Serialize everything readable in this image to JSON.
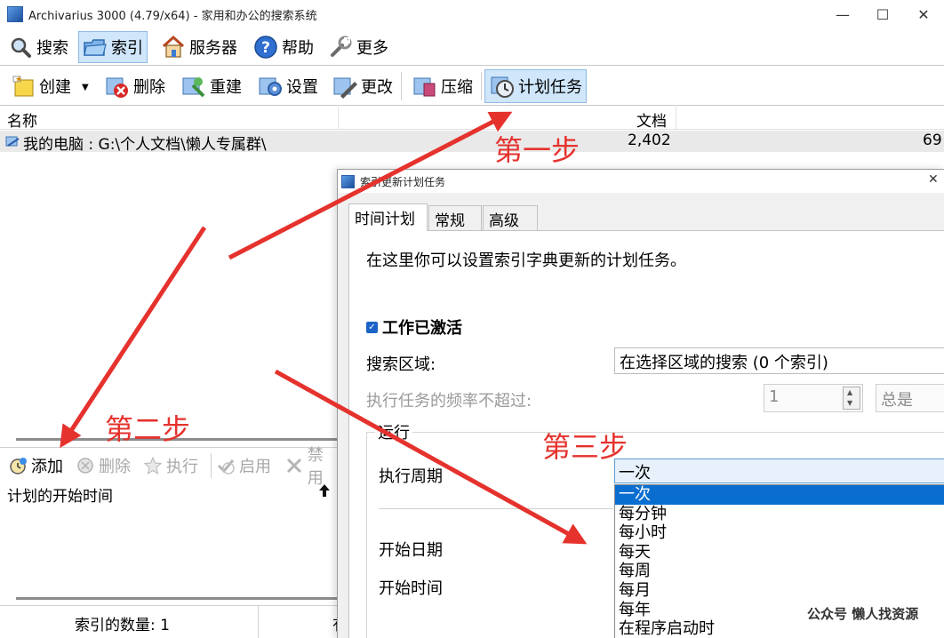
{
  "window": {
    "title": "Archivarius 3000 (4.79/x64) - 家用和办公的搜索系统",
    "controls": {
      "minimize": "—",
      "maximize": "☐",
      "close": "✕"
    }
  },
  "menubar": {
    "items": [
      {
        "label": "搜索",
        "icon": "search-icon"
      },
      {
        "label": "索引",
        "icon": "folder-icon",
        "active": true
      },
      {
        "label": "服务器",
        "icon": "house-icon"
      },
      {
        "label": "帮助",
        "icon": "help-icon"
      },
      {
        "label": "更多",
        "icon": "tools-icon"
      }
    ]
  },
  "toolbar": {
    "items": [
      {
        "label": "创建",
        "icon": "create-icon"
      },
      {
        "label": "删除",
        "icon": "delete-icon"
      },
      {
        "label": "重建",
        "icon": "rebuild-icon"
      },
      {
        "label": "设置",
        "icon": "settings-icon"
      },
      {
        "label": "更改",
        "icon": "edit-icon"
      },
      {
        "label": "压缩",
        "icon": "compress-icon"
      },
      {
        "label": "计划任务",
        "icon": "clock-icon",
        "active": true
      }
    ],
    "dropdown_arrow": "▼"
  },
  "index_list": {
    "columns": [
      "名称",
      "文档"
    ],
    "rows": [
      {
        "name": "我的电脑 : G:\\个人文档\\懒人专属群\\",
        "docs": "2,402",
        "extra": "69"
      }
    ]
  },
  "schedule_panel": {
    "toolbar": [
      {
        "label": "添加",
        "enabled": true
      },
      {
        "label": "删除",
        "enabled": false
      },
      {
        "label": "执行",
        "enabled": false
      },
      {
        "label": "启用",
        "enabled": false
      },
      {
        "label": "禁用",
        "enabled": false
      }
    ],
    "column": "计划的开始时间",
    "sort_arrow": "🡅"
  },
  "status": {
    "index_count": "索引的数量: 1",
    "cut_text": "有"
  },
  "dialog": {
    "title": "索引更新计划任务",
    "tabs": [
      "时间计划",
      "常规",
      "高级"
    ],
    "intro": "在这里你可以设置索引字典更新的计划任务。",
    "active_label": "工作已激活",
    "active_checked": true,
    "search_area_label": "搜索区域:",
    "search_area_value": "在选择区域的搜索 (0 个索引)",
    "freq_label": "执行任务的频率不超过:",
    "freq_value": "1",
    "freq_unit": "总是",
    "run_group": "运行",
    "period_label": "执行周期",
    "period_value": "一次",
    "start_date_label": "开始日期",
    "start_time_label": "开始时间",
    "period_options": [
      "一次",
      "每分钟",
      "每小时",
      "每天",
      "每周",
      "每月",
      "每年",
      "在程序启动时"
    ],
    "selected_option": 0
  },
  "annotations": {
    "step1": "第一步",
    "step2": "第二步",
    "step3": "第三步",
    "arrow_color": "#e5322d"
  },
  "watermark": "公众号  懒人找资源"
}
